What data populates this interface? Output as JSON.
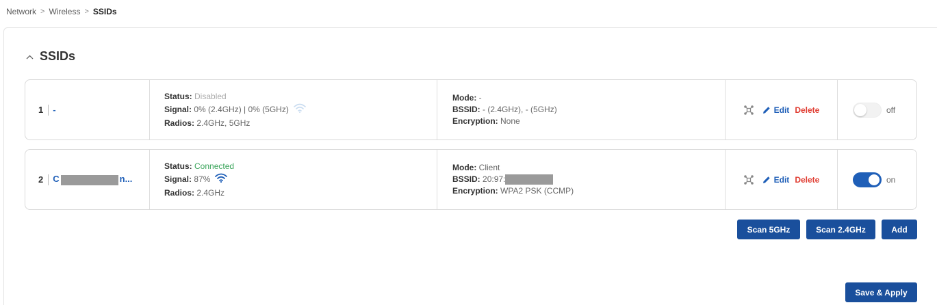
{
  "breadcrumb": {
    "items": [
      "Network",
      "Wireless"
    ],
    "current": "SSIDs"
  },
  "section": {
    "title": "SSIDs"
  },
  "labels": {
    "status": "Status:",
    "signal": "Signal:",
    "radios": "Radios:",
    "mode": "Mode:",
    "bssid": "BSSID:",
    "encryption": "Encryption:",
    "edit": "Edit",
    "delete": "Delete"
  },
  "ssids": [
    {
      "index": "1",
      "name": "-",
      "status": "Disabled",
      "signal": "0% (2.4GHz) | 0% (5GHz)",
      "radios": "2.4GHz, 5GHz",
      "mode": "-",
      "bssid": "- (2.4GHz), - (5GHz)",
      "encryption": "None",
      "toggle_label": "off",
      "enabled": false
    },
    {
      "index": "2",
      "name_prefix": "C",
      "name_suffix": "n...",
      "status": "Connected",
      "signal": "87%",
      "radios": "2.4GHz",
      "mode": "Client",
      "bssid_prefix": "20:97:",
      "encryption": "WPA2 PSK (CCMP)",
      "toggle_label": "on",
      "enabled": true
    }
  ],
  "buttons": {
    "scan5": "Scan 5GHz",
    "scan24": "Scan 2.4GHz",
    "add": "Add",
    "save": "Save & Apply"
  },
  "colors": {
    "primary": "#1a4f9c",
    "link": "#1f5fb8",
    "danger": "#e03c31",
    "success": "#3ca55c"
  },
  "icons": {
    "wifi": "wifi-icon",
    "scan": "scan-icon",
    "edit": "pencil-icon",
    "collapse": "chevron-up-icon"
  }
}
